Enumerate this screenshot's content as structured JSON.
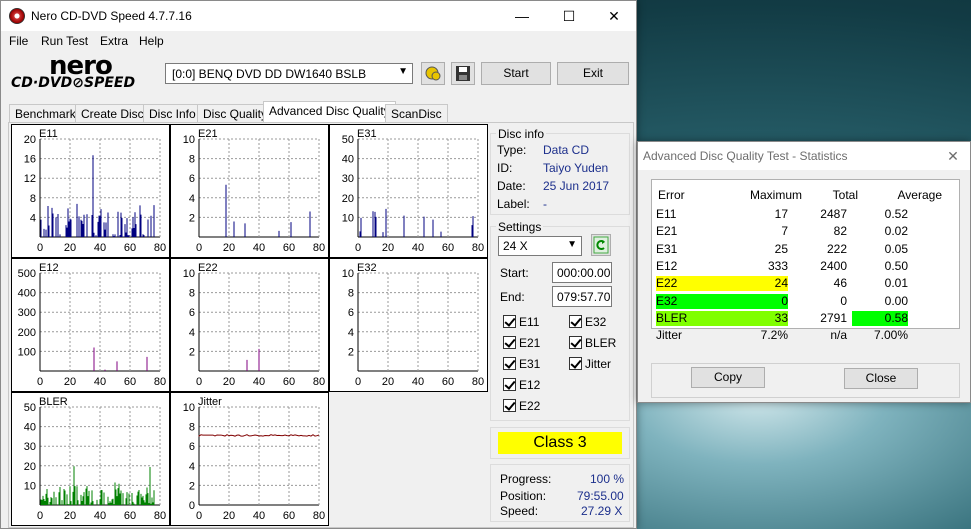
{
  "main_window": {
    "title": "Nero CD-DVD Speed 4.7.7.16",
    "minimize": "—",
    "maximize": "☐",
    "close": "✕"
  },
  "menu": [
    "File",
    "Run Test",
    "Extra",
    "Help"
  ],
  "logo": {
    "line1": "nero",
    "line2": "CD·DVD⊘SPEED"
  },
  "drive_select": {
    "value": "[0:0]   BENQ DVD DD DW1640 BSLB"
  },
  "toolbar": {
    "start_label": "Start",
    "exit_label": "Exit"
  },
  "tabs": [
    {
      "label": "Benchmark",
      "active": false
    },
    {
      "label": "Create Disc",
      "active": false
    },
    {
      "label": "Disc Info",
      "active": false
    },
    {
      "label": "Disc Quality",
      "active": false
    },
    {
      "label": "Advanced Disc Quality",
      "active": true
    },
    {
      "label": "ScanDisc",
      "active": false
    }
  ],
  "charts": [
    {
      "name": "E11",
      "yticks": [
        "20",
        "16",
        "12",
        "8",
        "4"
      ],
      "ymax": 20,
      "color": "#000080"
    },
    {
      "name": "E21",
      "yticks": [
        "10",
        "8",
        "6",
        "4",
        "2"
      ],
      "ymax": 10,
      "color": "#000080"
    },
    {
      "name": "E31",
      "yticks": [
        "50",
        "40",
        "30",
        "20",
        "10"
      ],
      "ymax": 50,
      "color": "#000080"
    },
    {
      "name": "E12",
      "yticks": [
        "500",
        "400",
        "300",
        "200",
        "100"
      ],
      "ymax": 500,
      "color": "#800080"
    },
    {
      "name": "E22",
      "yticks": [
        "10",
        "8",
        "6",
        "4",
        "2"
      ],
      "ymax": 10,
      "color": "#800080"
    },
    {
      "name": "E32",
      "yticks": [
        "10",
        "8",
        "6",
        "4",
        "2"
      ],
      "ymax": 10,
      "color": "#800080"
    },
    {
      "name": "BLER",
      "yticks": [
        "50",
        "40",
        "30",
        "20",
        "10"
      ],
      "ymax": 50,
      "color": "#008000"
    },
    {
      "name": "Jitter",
      "yticks": [
        "10",
        "8",
        "6",
        "4",
        "2",
        "0"
      ],
      "ymax": 10,
      "color": "#800000"
    }
  ],
  "xticks": [
    "0",
    "20",
    "40",
    "60",
    "80"
  ],
  "disc_info": {
    "title": "Disc info",
    "type_label": "Type:",
    "type_value": "Data CD",
    "id_label": "ID:",
    "id_value": "Taiyo Yuden",
    "date_label": "Date:",
    "date_value": "25 Jun 2017",
    "label_label": "Label:",
    "label_value": "-"
  },
  "settings": {
    "title": "Settings",
    "speed": "24 X",
    "start_label": "Start:",
    "start_value": "000:00.00",
    "end_label": "End:",
    "end_value": "079:57.70",
    "checks": [
      "E11",
      "E32",
      "E21",
      "BLER",
      "E31",
      "Jitter",
      "E12",
      "E22"
    ]
  },
  "class_label": "Class 3",
  "progress": {
    "progress_label": "Progress:",
    "progress_value": "100 %",
    "position_label": "Position:",
    "position_value": "79:55.00",
    "speed_label": "Speed:",
    "speed_value": "27.29 X"
  },
  "stats": {
    "title": "Advanced Disc Quality Test - Statistics",
    "close": "✕",
    "headers": [
      "Error",
      "Maximum",
      "Total",
      "Average"
    ],
    "rows": [
      {
        "error": "E11",
        "max": "17",
        "total": "2487",
        "avg": "0.52",
        "max_bg": "",
        "err_bg": "",
        "avg_bg": ""
      },
      {
        "error": "E21",
        "max": "7",
        "total": "82",
        "avg": "0.02",
        "max_bg": "",
        "err_bg": "",
        "avg_bg": ""
      },
      {
        "error": "E31",
        "max": "25",
        "total": "222",
        "avg": "0.05",
        "max_bg": "",
        "err_bg": "",
        "avg_bg": ""
      },
      {
        "error": "E12",
        "max": "333",
        "total": "2400",
        "avg": "0.50",
        "max_bg": "",
        "err_bg": "",
        "avg_bg": ""
      },
      {
        "error": "E22",
        "max": "24",
        "total": "46",
        "avg": "0.01",
        "max_bg": "#ffff00",
        "err_bg": "#ffff00",
        "avg_bg": ""
      },
      {
        "error": "E32",
        "max": "0",
        "total": "0",
        "avg": "0.00",
        "max_bg": "#00ff00",
        "err_bg": "#00ff00",
        "avg_bg": ""
      },
      {
        "error": "BLER",
        "max": "33",
        "total": "2791",
        "avg": "0.58",
        "max_bg": "#80ff00",
        "err_bg": "#80ff00",
        "avg_bg": "#00ff00"
      },
      {
        "error": "Jitter",
        "max": "7.2%",
        "total": "n/a",
        "avg": "7.00%",
        "max_bg": "",
        "err_bg": "",
        "avg_bg": ""
      }
    ],
    "copy_label": "Copy",
    "close_label": "Close"
  }
}
